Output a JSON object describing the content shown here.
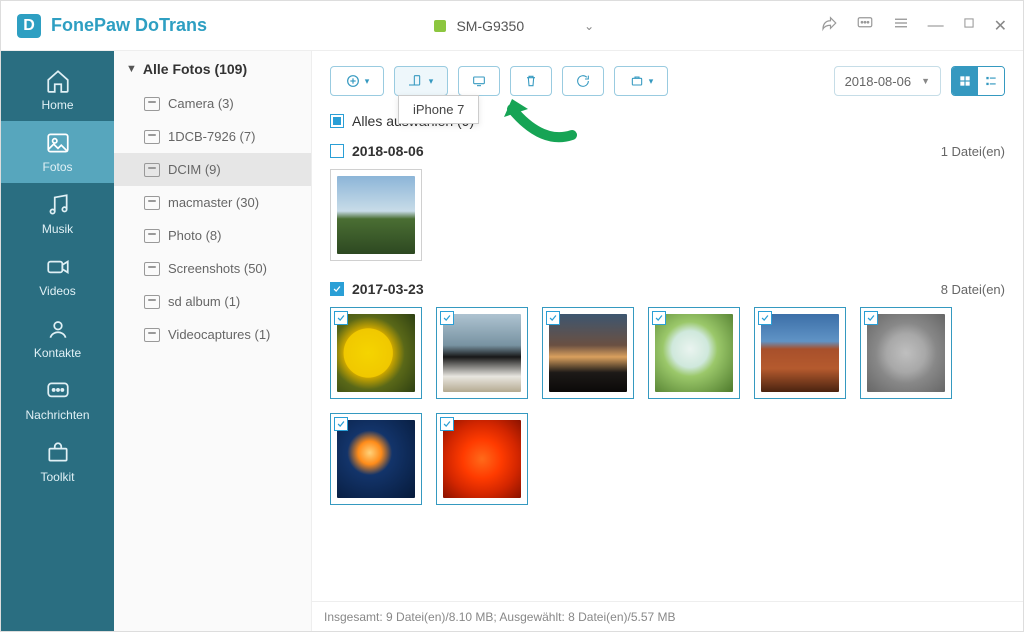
{
  "app": {
    "title": "FonePaw DoTrans"
  },
  "device": {
    "name": "SM-G9350"
  },
  "dropdown": {
    "target": "iPhone 7"
  },
  "nav": [
    {
      "id": "home",
      "label": "Home"
    },
    {
      "id": "photos",
      "label": "Fotos"
    },
    {
      "id": "music",
      "label": "Musik"
    },
    {
      "id": "videos",
      "label": "Videos"
    },
    {
      "id": "contacts",
      "label": "Kontakte"
    },
    {
      "id": "messages",
      "label": "Nachrichten"
    },
    {
      "id": "toolkit",
      "label": "Toolkit"
    }
  ],
  "tree": {
    "header": "Alle Fotos (109)",
    "folders": [
      {
        "label": "Camera (3)"
      },
      {
        "label": "1DCB-7926 (7)"
      },
      {
        "label": "DCIM (9)"
      },
      {
        "label": "macmaster (30)"
      },
      {
        "label": "Photo (8)"
      },
      {
        "label": "Screenshots (50)"
      },
      {
        "label": "sd album (1)"
      },
      {
        "label": "Videocaptures (1)"
      }
    ]
  },
  "toolbar": {
    "date_filter": "2018-08-06"
  },
  "select_all": {
    "label": "Alles auswählen (9)"
  },
  "groups": [
    {
      "date": "2018-08-06",
      "count": "1 Datei(en)"
    },
    {
      "date": "2017-03-23",
      "count": "8 Datei(en)"
    }
  ],
  "status": {
    "text": "Insgesamt: 9 Datei(en)/8.10 MB; Ausgewählt: 8 Datei(en)/5.57 MB"
  }
}
